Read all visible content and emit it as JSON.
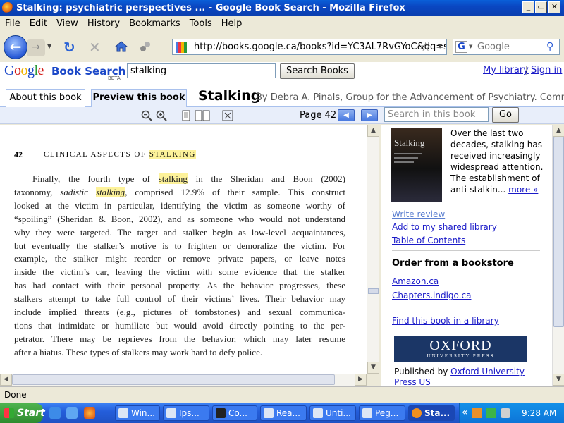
{
  "window": {
    "title": "Stalking: psychiatric perspectives ... - Google Book Search - Mozilla Firefox",
    "min": "_",
    "max": "▭",
    "close": "✕"
  },
  "menu": [
    "File",
    "Edit",
    "View",
    "History",
    "Bookmarks",
    "Tools",
    "Help"
  ],
  "nav": {
    "url": "http://books.google.ca/books?id=YC3AL7RvGYoC&dq=s",
    "search_placeholder": "Google"
  },
  "google": {
    "logo": [
      "G",
      "o",
      "o",
      "g",
      "l",
      "e"
    ],
    "product": "Book Search",
    "beta": "BETA",
    "query": "stalking",
    "search_button": "Search Books",
    "my_library": "My library",
    "separator": "|",
    "sign_in": "Sign in"
  },
  "tabs": {
    "about": "About this book",
    "preview": "Preview this book"
  },
  "book": {
    "title": "Stalking",
    "byline": "By Debra A. Pinals, Group for the Advancement of Psychiatry. Committee"
  },
  "viewer": {
    "page_label": "Page 42",
    "search_placeholder": "Search in this book",
    "go": "Go"
  },
  "page": {
    "number": "42",
    "header_prefix": "CLINICAL ASPECTS OF ",
    "header_hl": "STALKING",
    "lines": [
      [
        "Finally, the fourth type of ",
        "stalking",
        " in the Sheridan and Boon (2002)"
      ],
      [
        "taxonomy, ",
        "sadistic ",
        "stalking",
        ", comprised 12.9% of their sample. This construct"
      ],
      [
        "looked at the victim in particular, identifying the victim as someone worthy of"
      ],
      [
        "“spoiling” (Sheridan & Boon, 2002), and as someone who would not understand"
      ],
      [
        "why they were targeted. The target and stalker begin as low-level acquaintances,"
      ],
      [
        "but eventually the stalker’s motive is to frighten or demoralize the victim. For"
      ],
      [
        "example, the stalker might reorder or remove private papers, or leave notes"
      ],
      [
        "inside the victim’s car, leaving the victim with some evidence that the stalker"
      ],
      [
        "has had contact with their personal property. As the behavior progresses, these"
      ],
      [
        "stalkers attempt to take full control of their victims’ lives. Their behavior may"
      ],
      [
        "include implied threats (e.g., pictures of tombstones) and sexual communica-"
      ],
      [
        "tions that intimidate or humiliate but would avoid directly pointing to the per-"
      ],
      [
        "petrator. There may be reprieves from the behavior, which may later resume"
      ],
      [
        "after a hiatus. These types of stalkers may work hard to defy police."
      ]
    ]
  },
  "sidebar": {
    "cover_title": "Stalking",
    "description": "Over the last two decades, stalking has received increasingly widespread attention. The establishment of anti-stalkin...",
    "more": "more »",
    "write_review": "Write review",
    "add_shared": "Add to my shared library",
    "toc": "Table of Contents",
    "order_header": "Order from a bookstore",
    "stores": [
      "Amazon.ca",
      "Chapters.indigo.ca"
    ],
    "find_library": "Find this book in a library",
    "oxford": "OXFORD",
    "oxford_sub": "UNIVERSITY PRESS",
    "published_by": "Published by ",
    "publisher": "Oxford University Press US"
  },
  "status": "Done",
  "taskbar": {
    "start": "Start",
    "tasks": [
      "Win...",
      "Ips...",
      "Co...",
      "Rea...",
      "Unti...",
      "Peg...",
      "Sta..."
    ],
    "chevron": "«",
    "clock": "9:28 AM"
  }
}
